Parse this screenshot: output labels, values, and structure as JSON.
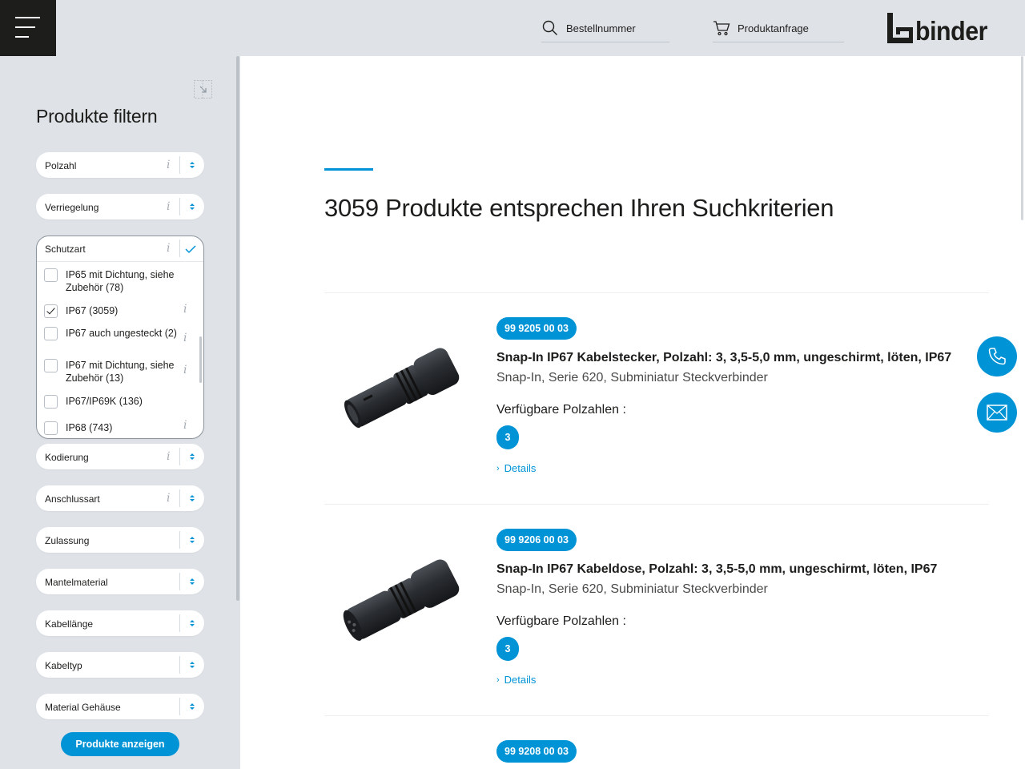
{
  "header": {
    "search_label": "Bestellnummer",
    "inquiry_label": "Produktanfrage",
    "logo_text": "binder"
  },
  "sidebar": {
    "title": "Produkte filtern",
    "filters": [
      {
        "label": "Polzahl",
        "info": "i"
      },
      {
        "label": "Verriegelung",
        "info": "i"
      },
      {
        "label": "Schutzart",
        "info": "i"
      },
      {
        "label": "Kodierung",
        "info": "i"
      },
      {
        "label": "Anschlussart",
        "info": "i"
      },
      {
        "label": "Zulassung"
      },
      {
        "label": "Mantelmaterial"
      },
      {
        "label": "Kabellänge"
      },
      {
        "label": "Kabeltyp"
      },
      {
        "label": "Material Gehäuse"
      }
    ],
    "schutzart_options": [
      {
        "label": "IP65 mit Dichtung, siehe Zubehör (78)",
        "checked": false,
        "info": ""
      },
      {
        "label": "IP67 (3059)",
        "checked": true,
        "info": "i"
      },
      {
        "label": "IP67 auch ungesteckt (2)",
        "checked": false,
        "info": "i"
      },
      {
        "label": "IP67 mit Dichtung, siehe Zubehör (13)",
        "checked": false,
        "info": "i"
      },
      {
        "label": "IP67/IP69K (136)",
        "checked": false,
        "info": ""
      },
      {
        "label": "IP68 (743)",
        "checked": false,
        "info": "i"
      }
    ],
    "show_button": "Produkte anzeigen"
  },
  "main": {
    "results_title": "3059 Produkte entsprechen Ihren Suchkriterien",
    "poles_label": "Verfügbare Polzahlen :",
    "details_label": "Details",
    "products": [
      {
        "order_no": "99 9205 00 03",
        "title": "Snap-In IP67 Kabelstecker, Polzahl: 3, 3,5-5,0 mm, ungeschirmt, löten, IP67",
        "subtitle": "Snap-In, Serie 620, Subminiatur Steckverbinder",
        "poles": "3"
      },
      {
        "order_no": "99 9206 00 03",
        "title": "Snap-In IP67 Kabeldose, Polzahl: 3, 3,5-5,0 mm, ungeschirmt, löten, IP67",
        "subtitle": "Snap-In, Serie 620, Subminiatur Steckverbinder",
        "poles": "3"
      },
      {
        "order_no": "99 9208 00 03"
      }
    ]
  },
  "icons": {
    "menu": "hamburger-menu-icon",
    "search": "search-icon",
    "cart": "cart-icon",
    "collapse": "collapse-sidebar-icon",
    "phone": "phone-icon",
    "mail": "mail-icon"
  },
  "colors": {
    "accent": "#0093d6",
    "header_bg": "#dfe3e8",
    "menu_bg": "#1d1d1b"
  }
}
